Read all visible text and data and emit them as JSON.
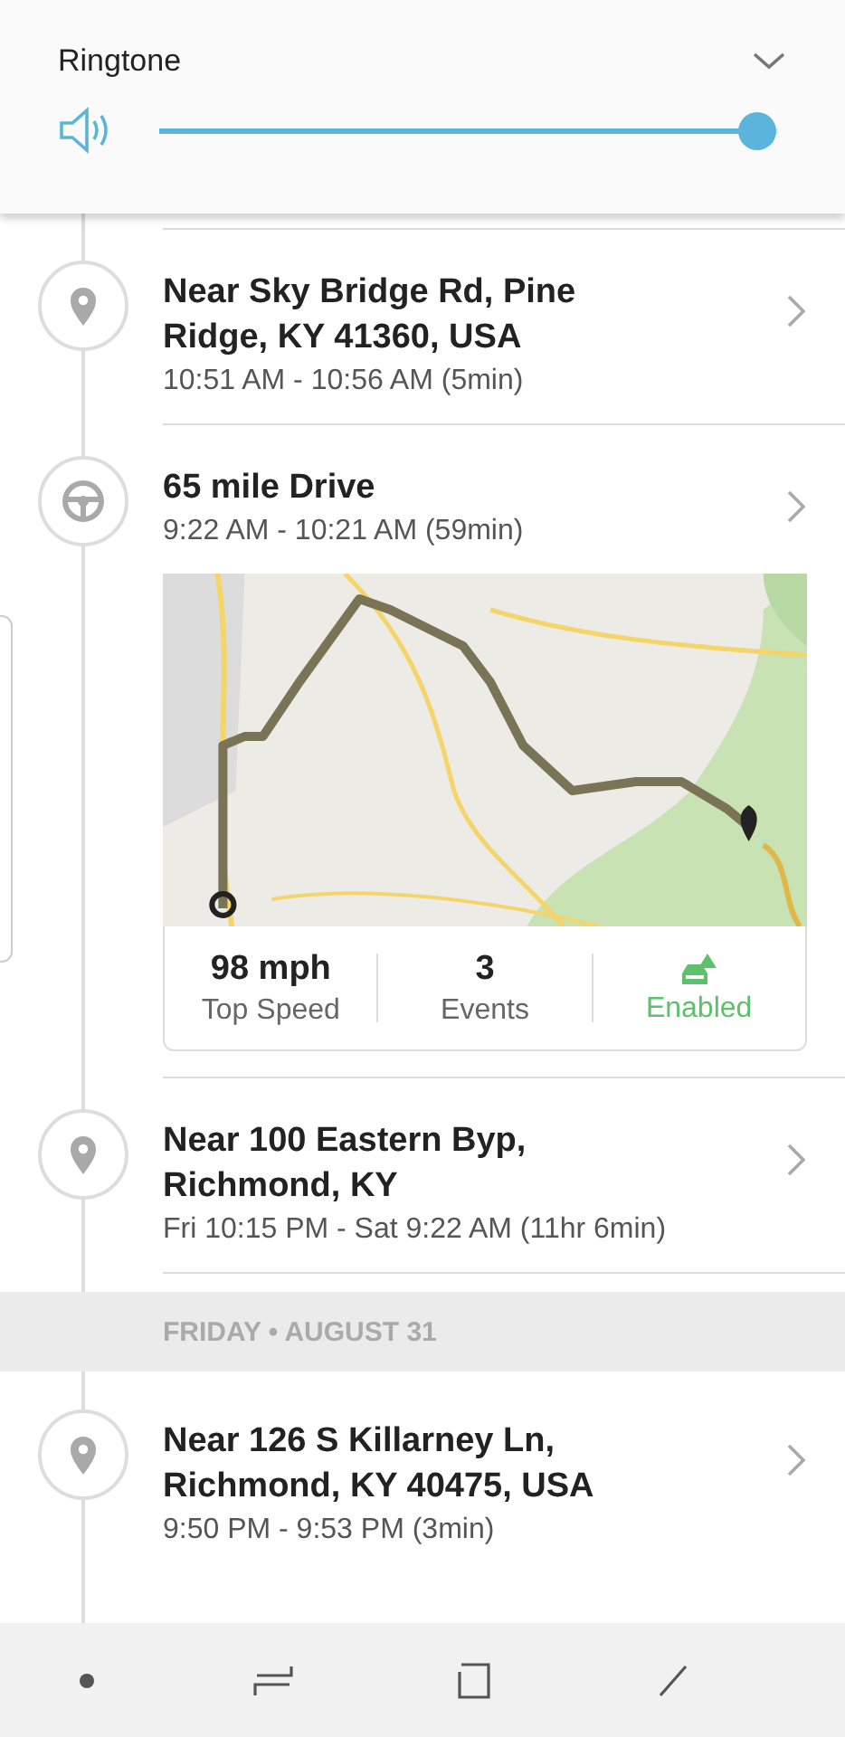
{
  "volume": {
    "label": "Ringtone",
    "level": 1
  },
  "timeline": [
    {
      "kind": "stop",
      "title": "Near Sky Bridge Rd, Pine Ridge, KY 41360, USA",
      "time": "10:51 AM - 10:56 AM (5min)"
    },
    {
      "kind": "drive",
      "title": "65 mile Drive",
      "time": "9:22 AM - 10:21 AM (59min)",
      "stats": [
        {
          "value": "98 mph",
          "label": "Top Speed",
          "kind": "text"
        },
        {
          "value": "3",
          "label": "Events",
          "kind": "text"
        },
        {
          "label": "Enabled",
          "kind": "status"
        }
      ]
    },
    {
      "kind": "stop",
      "title": "Near 100 Eastern Byp, Richmond, KY",
      "time": "Fri 10:15 PM - Sat 9:22 AM (11hr 6min)"
    },
    {
      "kind": "header",
      "title": "FRIDAY • AUGUST 31"
    },
    {
      "kind": "stop",
      "title": "Near 126 S Killarney Ln, Richmond, KY 40475, USA",
      "time": "9:50 PM - 9:53 PM (3min)"
    }
  ]
}
